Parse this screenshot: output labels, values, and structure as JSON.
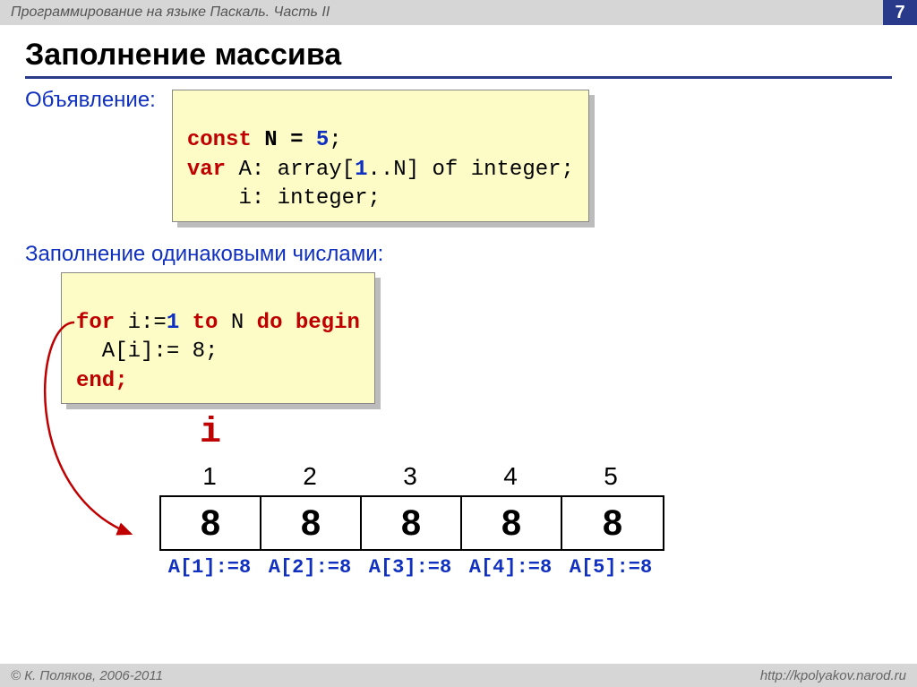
{
  "header": {
    "title": "Программирование на языке Паскаль. Часть II",
    "page": "7"
  },
  "slide": {
    "title": "Заполнение массива",
    "decl_label": "Объявление:",
    "code1": {
      "l1a": "const",
      "l1b": " N = ",
      "l1c": "5",
      "l1d": ";",
      "l2a": "var",
      "l2b": " A: array[",
      "l2c": "1",
      "l2d": "..N] of integer;",
      "l3": "    i: integer;"
    },
    "fill_label": "Заполнение одинаковыми числами:",
    "code2": {
      "l1a": "for",
      "l1b": " i:=",
      "l1c": "1",
      "l1d": " ",
      "l1e": "to",
      "l1f": " N ",
      "l1g": "do begin",
      "l2": "  A[i]:= 8;",
      "l3": "end;"
    },
    "diagram": {
      "i_label": "i",
      "indices": [
        "1",
        "2",
        "3",
        "4",
        "5"
      ],
      "cells": [
        "8",
        "8",
        "8",
        "8",
        "8"
      ],
      "assigns": [
        "A[1]:=8",
        "A[2]:=8",
        "A[3]:=8",
        "A[4]:=8",
        "A[5]:=8"
      ]
    }
  },
  "footer": {
    "left": "© К. Поляков, 2006-2011",
    "right": "http://kpolyakov.narod.ru"
  }
}
